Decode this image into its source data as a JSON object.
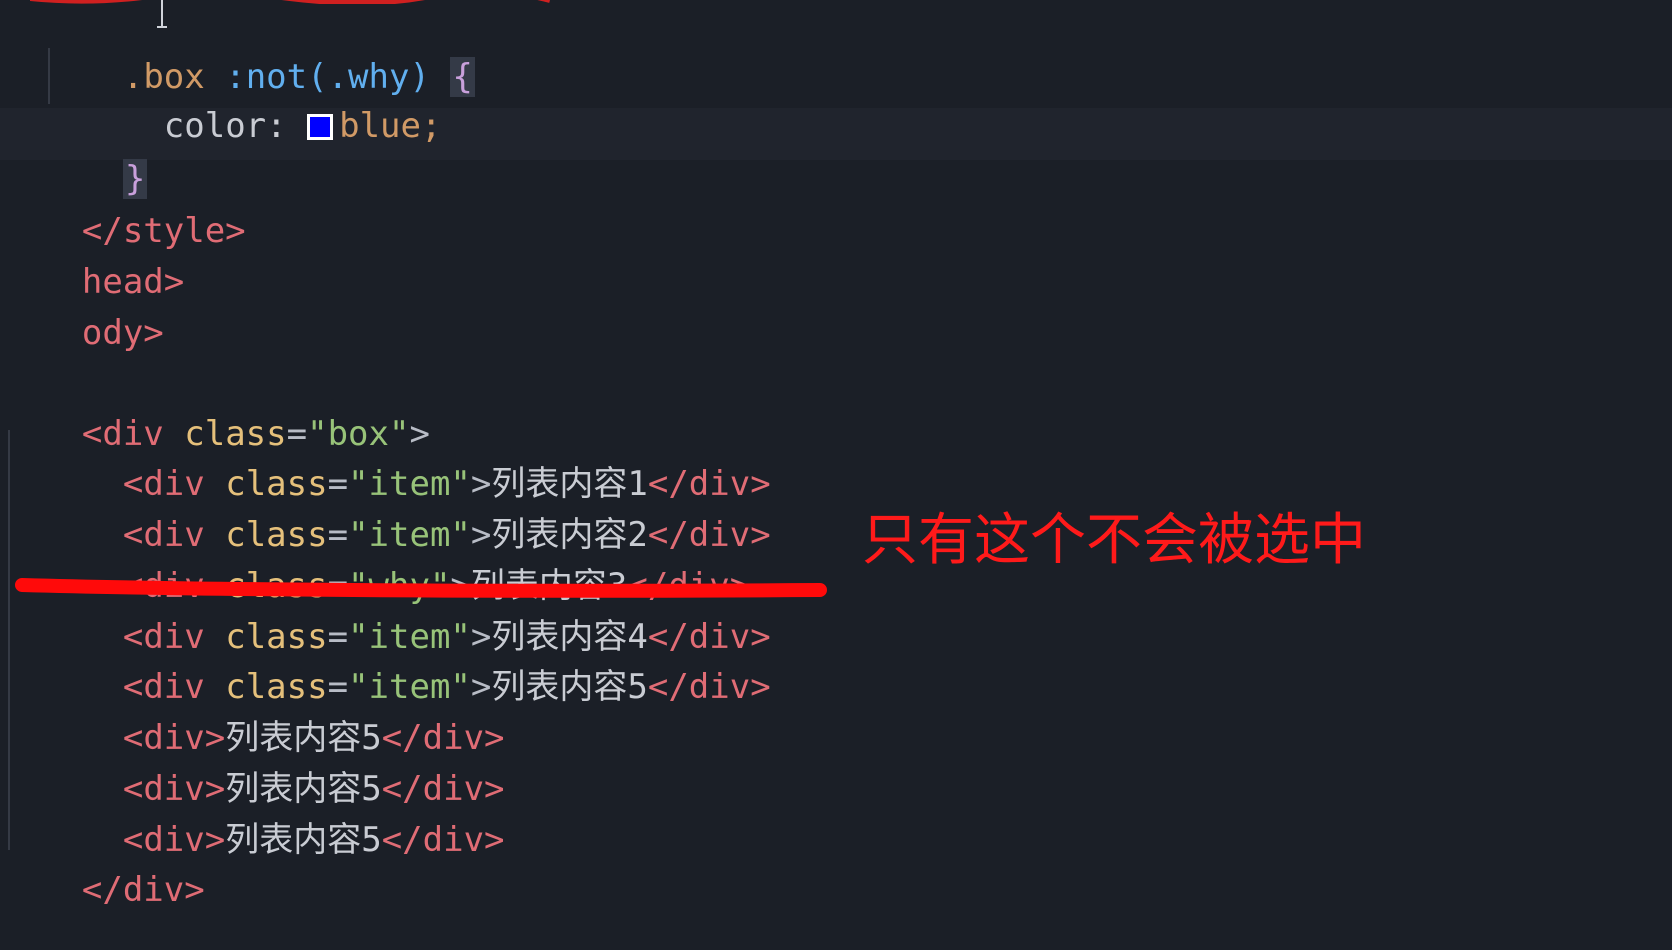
{
  "editor": {
    "lines": {
      "l1": {
        "selector": ".box",
        "pseudo": ":not(.why)",
        "brace_open": "{"
      },
      "l2": {
        "property": "color:",
        "value": "blue;",
        "swatch_color": "#0000ff"
      },
      "l3": {
        "brace_close": "}"
      },
      "l4": {
        "text": "</style>"
      },
      "l5": {
        "text": "head>"
      },
      "l6": {
        "text": "ody>"
      },
      "l8": {
        "open": "<div",
        "attr": "class",
        "eq": "=",
        "value": "\"box\"",
        "close": ">"
      },
      "items": [
        {
          "open": "<div",
          "attr": "class",
          "eq": "=",
          "value": "\"item\"",
          "gt": ">",
          "content": "列表内容1",
          "end": "</div>"
        },
        {
          "open": "<div",
          "attr": "class",
          "eq": "=",
          "value": "\"item\"",
          "gt": ">",
          "content": "列表内容2",
          "end": "</div>"
        },
        {
          "open": "<div",
          "attr": "class",
          "eq": "=",
          "value": "\"why\"",
          "gt": ">",
          "content": "列表内容3",
          "end": "</div>"
        },
        {
          "open": "<div",
          "attr": "class",
          "eq": "=",
          "value": "\"item\"",
          "gt": ">",
          "content": "列表内容4",
          "end": "</div>"
        },
        {
          "open": "<div",
          "attr": "class",
          "eq": "=",
          "value": "\"item\"",
          "gt": ">",
          "content": "列表内容5",
          "end": "</div>"
        }
      ],
      "plain_items": [
        {
          "open": "<div>",
          "content": "列表内容5",
          "end": "</div>"
        },
        {
          "open": "<div>",
          "content": "列表内容5",
          "end": "</div>"
        },
        {
          "open": "<div>",
          "content": "列表内容5",
          "end": "</div>"
        }
      ],
      "l17": {
        "text": "</div>"
      }
    },
    "annotation": {
      "text": "只有这个不会被选中",
      "color": "#ff1a1a"
    }
  }
}
